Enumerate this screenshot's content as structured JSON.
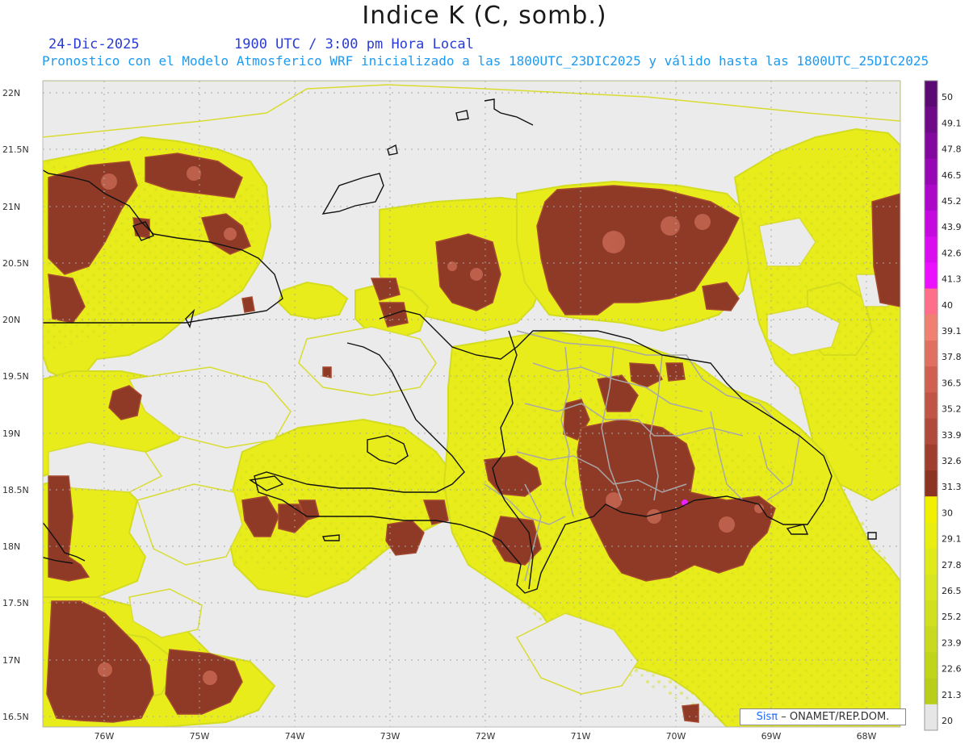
{
  "header": {
    "title": "Indice K (C, somb.)",
    "date": "24-Dic-2025",
    "time": "1900 UTC / 3:00 pm Hora Local",
    "subtitle": "Pronostico con el Modelo Atmosferico WRF inicializado a las 1800UTC_23DIC2025 y válido hasta las  1800UTC_25DIC2025"
  },
  "map": {
    "lat_labels": [
      "22N",
      "21.5N",
      "21N",
      "20.5N",
      "20N",
      "19.5N",
      "19N",
      "18.5N",
      "18N",
      "17.5N",
      "17N",
      "16.5N"
    ],
    "lon_labels": [
      "76W",
      "75W",
      "74W",
      "73W",
      "72W",
      "71W",
      "70W",
      "69W",
      "68W"
    ],
    "background_color": "#ebebeb",
    "coastline_color": "#111111",
    "border_color": "#a8a8a8"
  },
  "colorbar": {
    "levels": [
      "50",
      "49.1",
      "47.8",
      "46.5",
      "45.2",
      "43.9",
      "42.6",
      "41.3",
      "40",
      "39.1",
      "37.8",
      "36.5",
      "35.2",
      "33.9",
      "32.6",
      "31.3",
      "30",
      "29.1",
      "27.8",
      "26.5",
      "25.2",
      "23.9",
      "22.6",
      "21.3",
      "20"
    ],
    "colors": [
      "#5b0a73",
      "#6e0a88",
      "#82089e",
      "#9708b4",
      "#ad08c9",
      "#c40ade",
      "#d90df0",
      "#eb10ff",
      "#ff6f8a",
      "#f08070",
      "#e07060",
      "#d06050",
      "#c05545",
      "#b04a3a",
      "#a03e2e",
      "#8c3322",
      "#f0f000",
      "#e8ee10",
      "#e0ea18",
      "#d8e620",
      "#d0e020",
      "#c8da20",
      "#c0d41a",
      "#b8ce18",
      "#e6e6e6"
    ]
  },
  "credit": {
    "sis": "Sisπ",
    "rest": "– ONAMET/REP.DOM."
  }
}
